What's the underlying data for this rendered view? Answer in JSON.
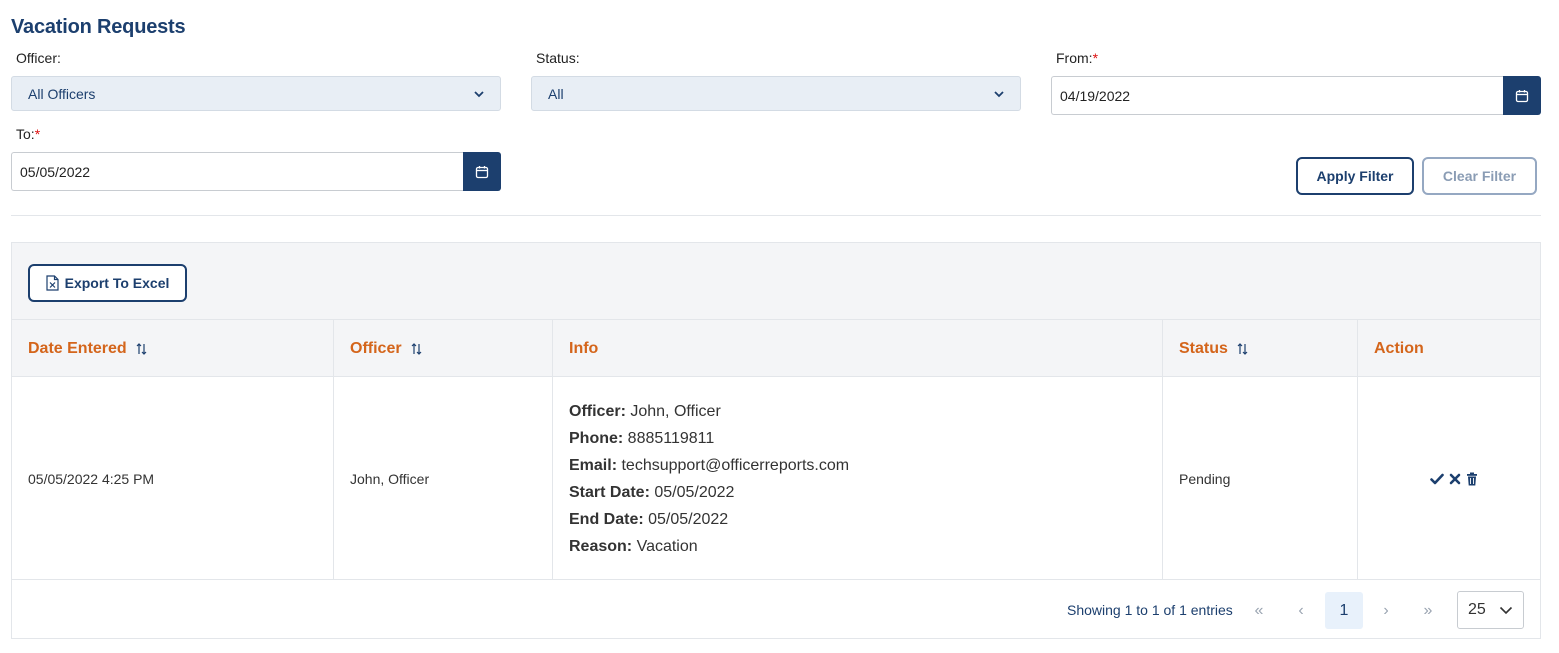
{
  "page": {
    "title": "Vacation Requests"
  },
  "filters": {
    "officer_label": "Officer:",
    "officer_value": "All Officers",
    "status_label": "Status:",
    "status_value": "All",
    "from_label": "From:",
    "from_value": "04/19/2022",
    "to_label": "To:",
    "to_value": "05/05/2022",
    "required_mark": "*",
    "apply_label": "Apply Filter",
    "clear_label": "Clear Filter"
  },
  "toolbar": {
    "export_label": "Export To Excel"
  },
  "table": {
    "headers": {
      "date_entered": "Date Entered",
      "officer": "Officer",
      "info": "Info",
      "status": "Status",
      "action": "Action"
    },
    "rows": [
      {
        "date_entered": "05/05/2022 4:25 PM",
        "officer": "John, Officer",
        "info": {
          "officer_label": "Officer:",
          "officer": "John, Officer",
          "phone_label": "Phone:",
          "phone": "8885119811",
          "email_label": "Email:",
          "email": "techsupport@officerreports.com",
          "start_label": "Start Date:",
          "start": "05/05/2022",
          "end_label": "End Date:",
          "end": "05/05/2022",
          "reason_label": "Reason:",
          "reason": "Vacation"
        },
        "status": "Pending",
        "actions": [
          "check-icon",
          "x-icon",
          "trash-icon"
        ]
      }
    ]
  },
  "pagination": {
    "showing": "Showing 1 to 1 of 1 entries",
    "first": "«",
    "prev": "‹",
    "current": "1",
    "next": "›",
    "last": "»",
    "page_size": "25"
  },
  "colors": {
    "primary": "#1c3f6e",
    "header_text": "#d4651b",
    "required": "#dd1111"
  }
}
